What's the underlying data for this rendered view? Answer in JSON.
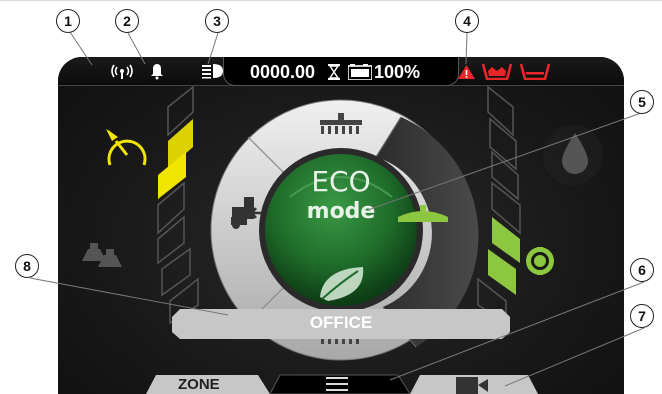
{
  "status": {
    "counter": "0000.00",
    "battery": "100%"
  },
  "mode": {
    "line1": "ECO",
    "line2": "mode"
  },
  "area_label": "OFFICE",
  "bottom_tabs": {
    "zone": "ZONE"
  },
  "callouts": [
    "1",
    "2",
    "3",
    "4",
    "5",
    "6",
    "7",
    "8"
  ],
  "gauges": {
    "left_level_fraction": 0.4,
    "right_level_fraction": 0.4
  },
  "colors": {
    "accent_yellow": "#f2e600",
    "accent_green": "#8dc63f",
    "alarm_red": "#e8262a",
    "eco_green": "#1f6b2a"
  },
  "icons": {
    "signal": "antenna-signal-icon",
    "bell": "bell-icon",
    "headlight": "headlight-icon",
    "hourglass": "hourglass-icon",
    "battery": "battery-icon",
    "warning": "warning-triangle-icon",
    "tanks": "tank-icons",
    "speed": "speedometer-icon",
    "weights": "weights-icon",
    "water": "water-drop-icon",
    "vacuum": "vacuum-target-icon",
    "menu": "hamburger-menu-icon",
    "camera": "camera-icon"
  }
}
